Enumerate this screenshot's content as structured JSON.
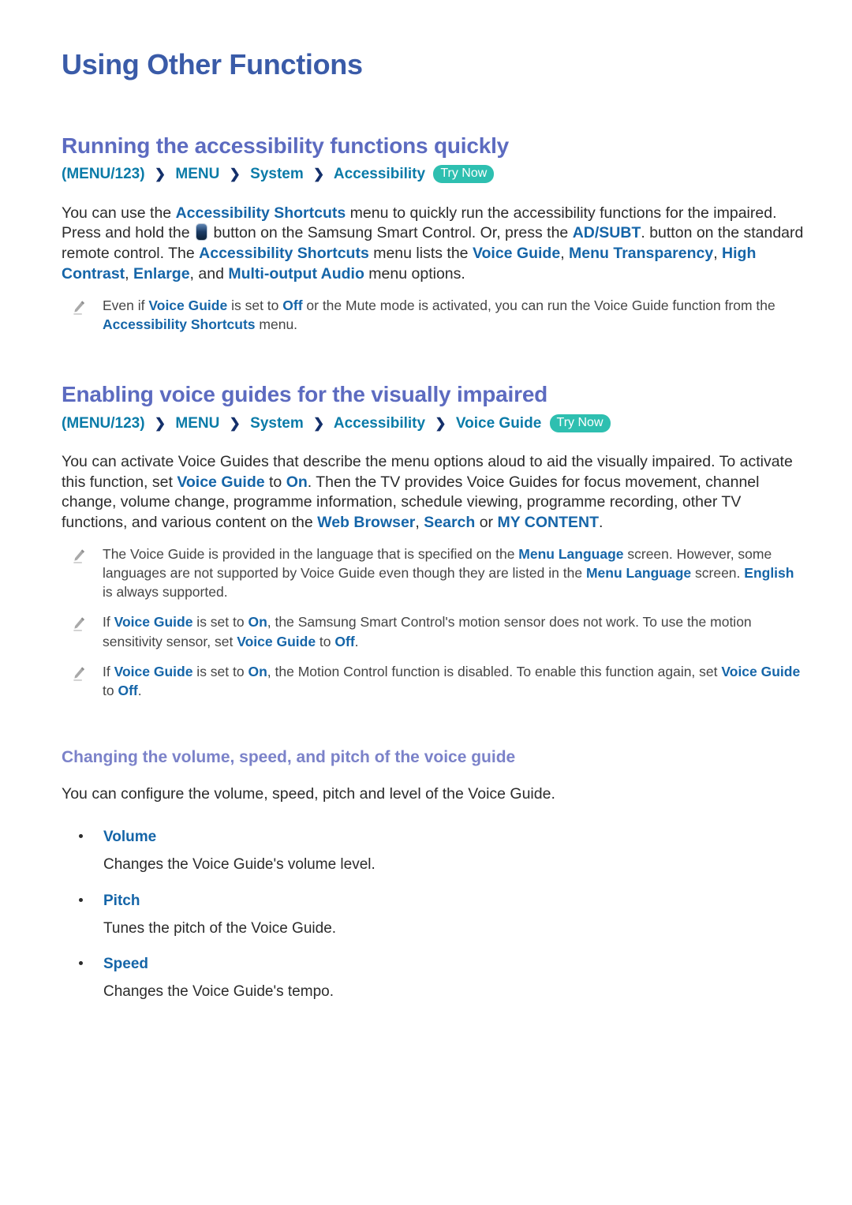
{
  "page": {
    "title": "Using Other Functions"
  },
  "colors": {
    "page_title": "#3a5ba8",
    "heading": "#5c6bc0",
    "subheading": "#7b82c9",
    "breadcrumb": "#0a7ba8",
    "link": "#1565a8",
    "try_now_badge": "#2ebfb0",
    "body": "#2b2b2b"
  },
  "sections": [
    {
      "heading": "Running the accessibility functions quickly",
      "breadcrumb": {
        "crumbs": [
          "(MENU/123)",
          "MENU",
          "System",
          "Accessibility"
        ],
        "separator": "❯",
        "badge": "Try Now"
      },
      "paragraph": {
        "p1a": "You can use the ",
        "p1_link1": "Accessibility Shortcuts",
        "p1b": " menu to quickly run the accessibility functions for the impaired. Press and hold the ",
        "p1_icon": "remote-control-button-icon",
        "p1c": " button on the Samsung Smart Control. Or, press the ",
        "p1_link2": "AD/SUBT",
        "p1d": ". button on the standard remote control. The ",
        "p1_link3": "Accessibility Shortcuts",
        "p1e": " menu lists the ",
        "p1_link4": "Voice Guide",
        "p1f": ", ",
        "p1_link5": "Menu Transparency",
        "p1g": ", ",
        "p1_link6": "High Contrast",
        "p1h": ", ",
        "p1_link7": "Enlarge",
        "p1i": ", and ",
        "p1_link8": "Multi-output Audio",
        "p1j": " menu options."
      },
      "notes": [
        {
          "icon": "pencil-icon",
          "a": "Even if ",
          "link1": "Voice Guide",
          "b": " is set to ",
          "link2": "Off",
          "c": " or the Mute mode is activated, you can run the Voice Guide function from the ",
          "link3": "Accessibility Shortcuts",
          "d": " menu."
        }
      ]
    },
    {
      "heading": "Enabling voice guides for the visually impaired",
      "breadcrumb": {
        "crumbs": [
          "(MENU/123)",
          "MENU",
          "System",
          "Accessibility",
          "Voice Guide"
        ],
        "separator": "❯",
        "badge": "Try Now"
      },
      "paragraph": {
        "p1a": "You can activate Voice Guides that describe the menu options aloud to aid the visually impaired. To activate this function, set ",
        "p1_link1": "Voice Guide",
        "p1b": " to ",
        "p1_link2": "On",
        "p1c": ". Then the TV provides Voice Guides for focus movement, channel change, volume change, programme information, schedule viewing, programme recording, other TV functions, and various content on the ",
        "p1_link3": "Web Browser",
        "p1d": ", ",
        "p1_link4": "Search",
        "p1e": " or ",
        "p1_link5": "MY CONTENT",
        "p1f": "."
      },
      "notes": [
        {
          "icon": "pencil-icon",
          "a": "The Voice Guide is provided in the language that is specified on the ",
          "link1": "Menu Language",
          "b": " screen. However, some languages are not supported by Voice Guide even though they are listed in the ",
          "link2": "Menu Language",
          "c": " screen. ",
          "link3": "English",
          "d": " is always supported."
        },
        {
          "icon": "pencil-icon",
          "a": "If ",
          "link1": "Voice Guide",
          "b": " is set to ",
          "link2": "On",
          "c": ", the Samsung Smart Control's motion sensor does not work. To use the motion sensitivity sensor, set ",
          "link3": "Voice Guide",
          "d": " to ",
          "link4": "Off",
          "e": "."
        },
        {
          "icon": "pencil-icon",
          "a": "If ",
          "link1": "Voice Guide",
          "b": " is set to ",
          "link2": "On",
          "c": ", the Motion Control function is disabled. To enable this function again, set ",
          "link3": "Voice Guide",
          "d": " to ",
          "link4": "Off",
          "e": "."
        }
      ],
      "subsection": {
        "heading": "Changing the volume, speed, and pitch of the voice guide",
        "intro": "You can configure the volume, speed, pitch and level of the Voice Guide.",
        "items": [
          {
            "label": "Volume",
            "description": "Changes the Voice Guide's volume level."
          },
          {
            "label": "Pitch",
            "description": "Tunes the pitch of the Voice Guide."
          },
          {
            "label": "Speed",
            "description": "Changes the Voice Guide's tempo."
          }
        ]
      }
    }
  ]
}
